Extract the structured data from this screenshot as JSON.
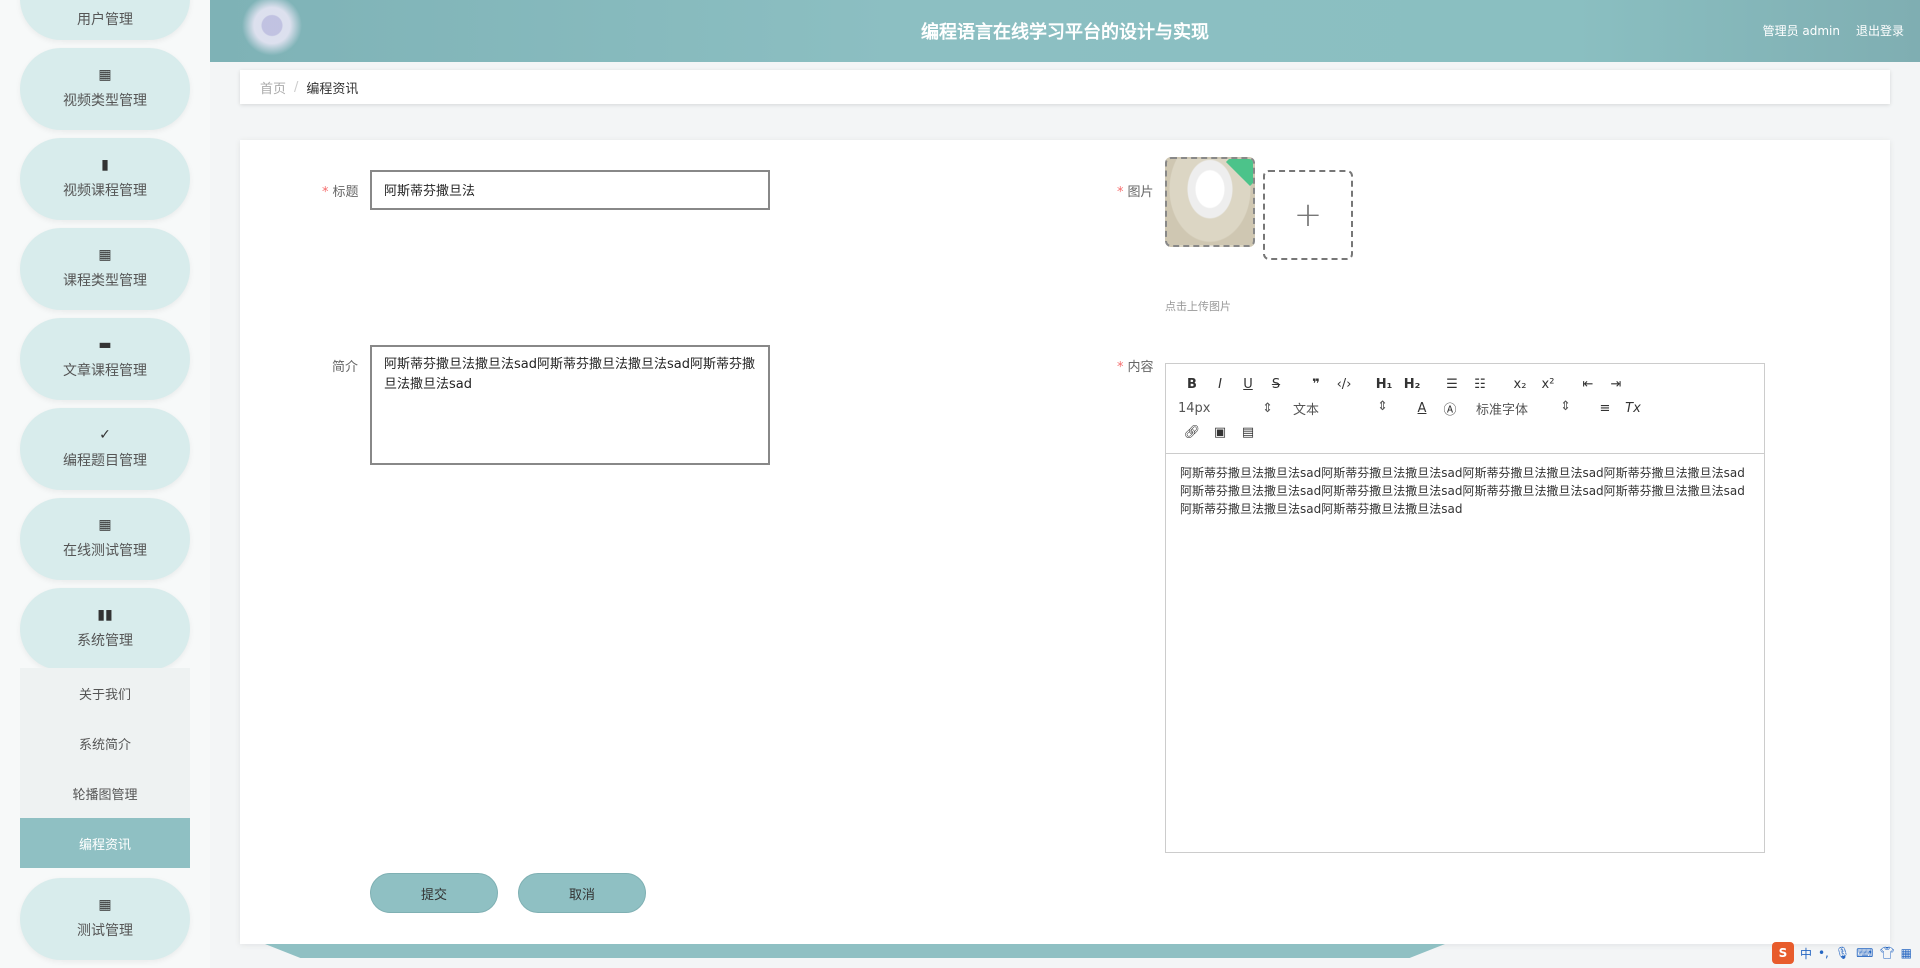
{
  "header": {
    "title": "编程语言在线学习平台的设计与实现",
    "user": "管理员 admin",
    "logout": "退出登录"
  },
  "sidebar": {
    "items": [
      {
        "label": "用户管理",
        "icon": "user-icon",
        "glyph": ""
      },
      {
        "label": "视频类型管理",
        "icon": "grid-icon",
        "glyph": "▦"
      },
      {
        "label": "视频课程管理",
        "icon": "book-icon",
        "glyph": "▮"
      },
      {
        "label": "课程类型管理",
        "icon": "grid-icon",
        "glyph": "▪▪"
      },
      {
        "label": "文章课程管理",
        "icon": "briefcase-icon",
        "glyph": "▬"
      },
      {
        "label": "编程题目管理",
        "icon": "clipboard-icon",
        "glyph": "✓"
      },
      {
        "label": "在线测试管理",
        "icon": "grid-icon",
        "glyph": "▪▪"
      },
      {
        "label": "系统管理",
        "icon": "bar-chart-icon",
        "glyph": "▮▮"
      },
      {
        "label": "测试管理",
        "icon": "grid-icon",
        "glyph": "▪▪"
      }
    ],
    "subitems": [
      {
        "label": "关于我们",
        "active": false
      },
      {
        "label": "系统简介",
        "active": false
      },
      {
        "label": "轮播图管理",
        "active": false
      },
      {
        "label": "编程资讯",
        "active": true
      }
    ]
  },
  "breadcrumb": {
    "home": "首页",
    "separator": "/",
    "current": "编程资讯"
  },
  "form": {
    "title_label": "标题",
    "title_value": "阿斯蒂芬撒旦法",
    "intro_label": "简介",
    "intro_value": "阿斯蒂芬撒旦法撒旦法sad阿斯蒂芬撒旦法撒旦法sad阿斯蒂芬撒旦法撒旦法sad",
    "image_label": "图片",
    "upload_tip": "点击上传图片",
    "content_label": "内容",
    "content_value": "阿斯蒂芬撒旦法撒旦法sad阿斯蒂芬撒旦法撒旦法sad阿斯蒂芬撒旦法撒旦法sad阿斯蒂芬撒旦法撒旦法sad阿斯蒂芬撒旦法撒旦法sad阿斯蒂芬撒旦法撒旦法sad阿斯蒂芬撒旦法撒旦法sad阿斯蒂芬撒旦法撒旦法sad阿斯蒂芬撒旦法撒旦法sad阿斯蒂芬撒旦法撒旦法sad",
    "submit": "提交",
    "cancel": "取消"
  },
  "editor": {
    "font_size": "14px",
    "header_select": "文本",
    "font_family": "标准字体"
  },
  "colors": {
    "accent": "#8fc0c3",
    "required": "#f56c6c"
  },
  "ime": {
    "logo": "S",
    "lang": "中"
  }
}
